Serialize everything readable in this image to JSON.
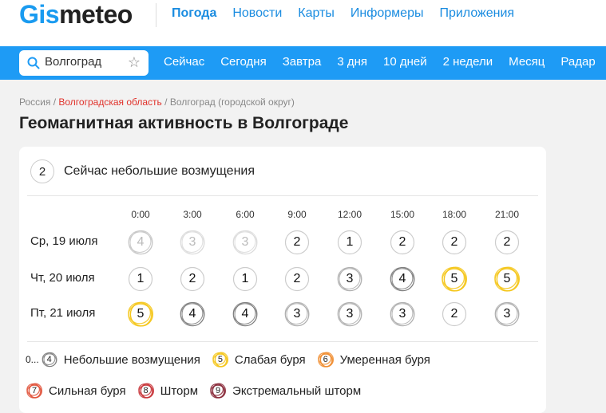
{
  "header": {
    "logo_part1": "Gis",
    "logo_part2": "meteo",
    "nav": [
      "Погода",
      "Новости",
      "Карты",
      "Информеры",
      "Приложения"
    ]
  },
  "search": {
    "value": "Волгоград",
    "icon": "search-icon",
    "favorite_icon": "star-icon"
  },
  "subnav": [
    "Сейчас",
    "Сегодня",
    "Завтра",
    "3 дня",
    "10 дней",
    "2 недели",
    "Месяц",
    "Радар"
  ],
  "breadcrumb": {
    "country": "Россия",
    "sep": "/",
    "region": "Волгоградская область",
    "city": "Волгоград (городской округ)"
  },
  "page_title": "Геомагнитная активность в Волгограде",
  "current": {
    "value": "2",
    "text": "Сейчас небольшие возмущения"
  },
  "forecast": {
    "times": [
      "0:00",
      "3:00",
      "6:00",
      "9:00",
      "12:00",
      "15:00",
      "18:00",
      "21:00"
    ],
    "rows": [
      {
        "label": "Ср, 19 июля",
        "values": [
          "4",
          "3",
          "3",
          "2",
          "1",
          "2",
          "2",
          "2"
        ],
        "faded_count": 3
      },
      {
        "label": "Чт, 20 июля",
        "values": [
          "1",
          "2",
          "1",
          "2",
          "3",
          "4",
          "5",
          "5"
        ],
        "faded_count": 0
      },
      {
        "label": "Пт, 21 июля",
        "values": [
          "5",
          "4",
          "4",
          "3",
          "3",
          "3",
          "2",
          "3"
        ],
        "faded_count": 0
      }
    ]
  },
  "legend": {
    "prefix": "0...",
    "items": [
      {
        "value": "4",
        "label": "Небольшие возмущения"
      },
      {
        "value": "5",
        "label": "Слабая буря"
      },
      {
        "value": "6",
        "label": "Умеренная буря"
      },
      {
        "value": "7",
        "label": "Сильная буря"
      },
      {
        "value": "8",
        "label": "Шторм"
      },
      {
        "value": "9",
        "label": "Экстремальный шторм"
      }
    ]
  },
  "colors": {
    "brand_blue": "#1e9bf5",
    "link_blue": "#1a8ce0",
    "breadcrumb_red": "#e0322b",
    "level_1_3": "#cccccc",
    "level_3": "#aaaaaa",
    "level_4": "#777777",
    "level_5": "#f5c518",
    "level_6": "#f08c2e",
    "level_7": "#e0523a",
    "level_8": "#c8353a",
    "level_9": "#8a2a3a"
  }
}
